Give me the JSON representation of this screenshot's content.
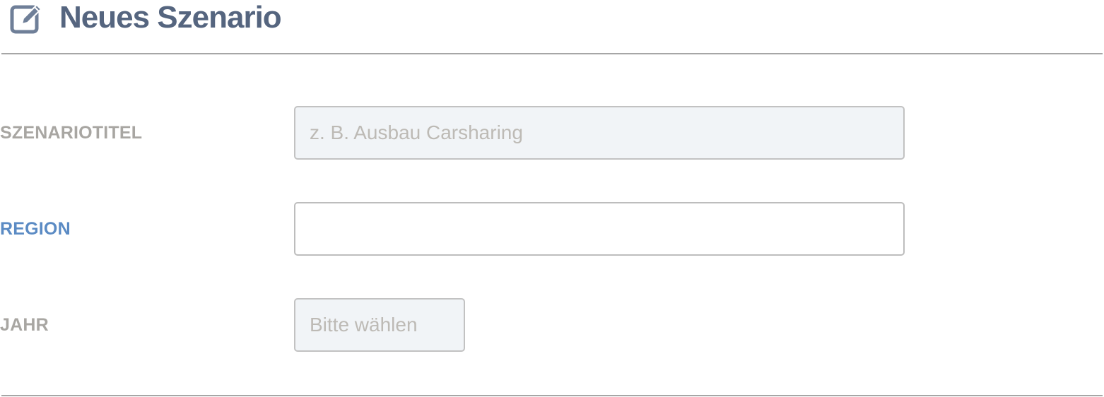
{
  "header": {
    "title": "Neues Szenario",
    "icon": "edit-icon",
    "icon_color": "#6f7f98",
    "title_color": "#55657f"
  },
  "form": {
    "scenario_title": {
      "label": "SZENARIOTITEL",
      "value": "",
      "placeholder": "z. B. Ausbau Carsharing"
    },
    "region": {
      "label": "REGION",
      "value": "",
      "placeholder": "",
      "label_color": "#5b8bc4"
    },
    "year": {
      "label": "JAHR",
      "selected": "Bitte wählen"
    }
  },
  "colors": {
    "label": "#a8a6a2",
    "active_label": "#5b8bc4",
    "field_background": "#f1f4f7",
    "field_border": "#c2c2c2",
    "divider": "#a6a6a6"
  }
}
